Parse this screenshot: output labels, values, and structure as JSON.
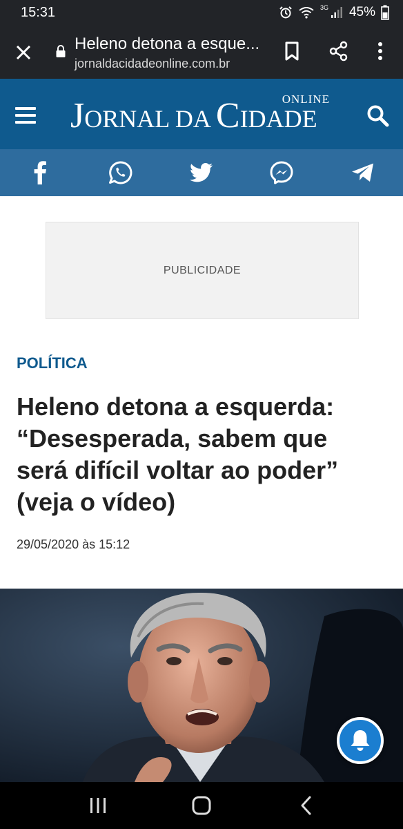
{
  "status_bar": {
    "time": "15:31",
    "network": "3G",
    "battery": "45%"
  },
  "browser": {
    "page_title": "Heleno detona a esque...",
    "url": "jornaldacidadeonline.com.br"
  },
  "site": {
    "logo_online": "ONLINE",
    "logo_j": "J",
    "logo_ornal": "ORNAL DA ",
    "logo_c": "C",
    "logo_idade": "IDADE",
    "brand_color": "#0f5a8e",
    "share_bar_color": "#2e6c9e"
  },
  "share_icons": [
    "facebook-icon",
    "whatsapp-icon",
    "twitter-icon",
    "messenger-icon",
    "telegram-icon"
  ],
  "ad": {
    "label": "PUBLICIDADE"
  },
  "article": {
    "category": "POLÍTICA",
    "headline_lines": [
      "Heleno detona a esquerda:",
      "“Desesperada, sabem que",
      "será difícil voltar ao poder”",
      "(veja o vídeo)"
    ],
    "date": "29/05/2020 às 15:12"
  }
}
